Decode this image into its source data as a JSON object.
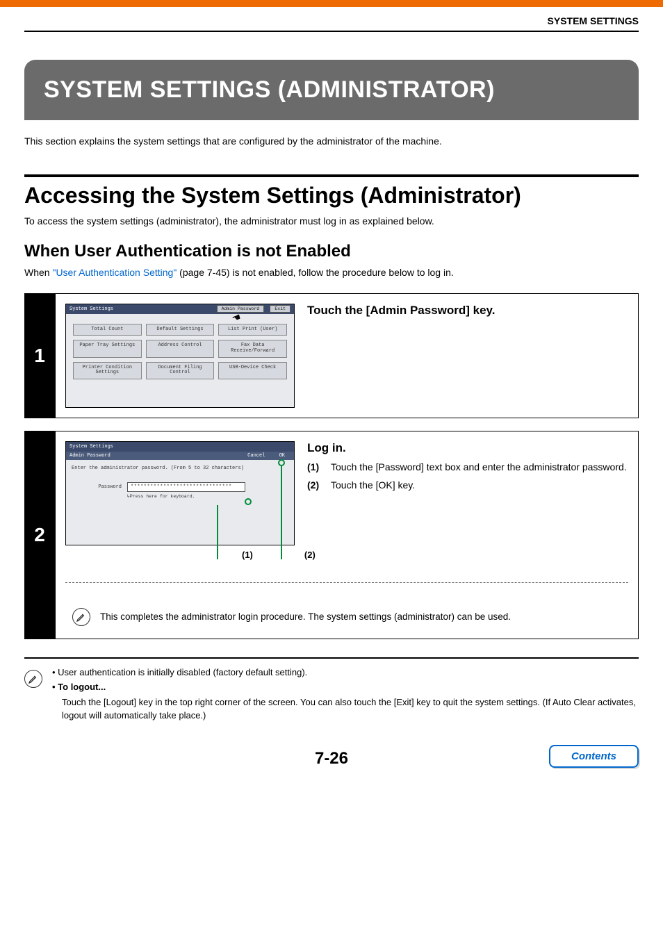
{
  "header": {
    "label": "SYSTEM SETTINGS"
  },
  "title": "SYSTEM SETTINGS (ADMINISTRATOR)",
  "intro": "This section explains the system settings that are configured by the administrator of the machine.",
  "section1": {
    "heading": "Accessing the System Settings (Administrator)",
    "text": "To access the system settings (administrator), the administrator must log in as explained below."
  },
  "section2": {
    "heading": "When User Authentication is not Enabled",
    "prefix": "When ",
    "link": "\"User Authentication Setting\"",
    "suffix": " (page 7-45) is not enabled, follow the procedure below to log in."
  },
  "step1": {
    "num": "1",
    "instruction": "Touch the [Admin Password] key.",
    "panel": {
      "title": "System Settings",
      "btn_admin": "Admin Password",
      "btn_exit": "Exit",
      "cells": {
        "total": "Total Count",
        "default": "Default Settings",
        "list": "List Print\n(User)",
        "tray": "Paper Tray\nSettings",
        "addr": "Address Control",
        "fax": "Fax Data\nReceive/Forward",
        "printer": "Printer Condition\nSettings",
        "docfile": "Document Filing\nControl",
        "usb": "USB-Device Check"
      }
    }
  },
  "step2": {
    "num": "2",
    "panel": {
      "title": "System Settings",
      "subtitle": "Admin Password",
      "btn_cancel": "Cancel",
      "btn_ok": "OK",
      "instr": "Enter the administrator password. (From 5 to 32 characters)",
      "pw_label": "Password",
      "pw_value": "*******************************",
      "pw_hint": "↳Press here for keyboard."
    },
    "callouts": {
      "c1": "(1)",
      "c2": "(2)"
    },
    "title": "Log in.",
    "sub1_n": "(1)",
    "sub1": "Touch the [Password] text box and enter the administrator password.",
    "sub2_n": "(2)",
    "sub2": "Touch the [OK] key.",
    "note": "This completes the administrator login procedure. The system settings (administrator) can be used."
  },
  "info": {
    "bullet1": "• User authentication is initially disabled (factory default setting).",
    "bullet2_label": "• To logout...",
    "bullet2_text": "Touch the [Logout] key in the top right corner of the screen. You can also touch the [Exit] key to quit the system settings. (If Auto Clear activates, logout will automatically take place.)"
  },
  "page_number": "7-26",
  "contents_btn": "Contents"
}
